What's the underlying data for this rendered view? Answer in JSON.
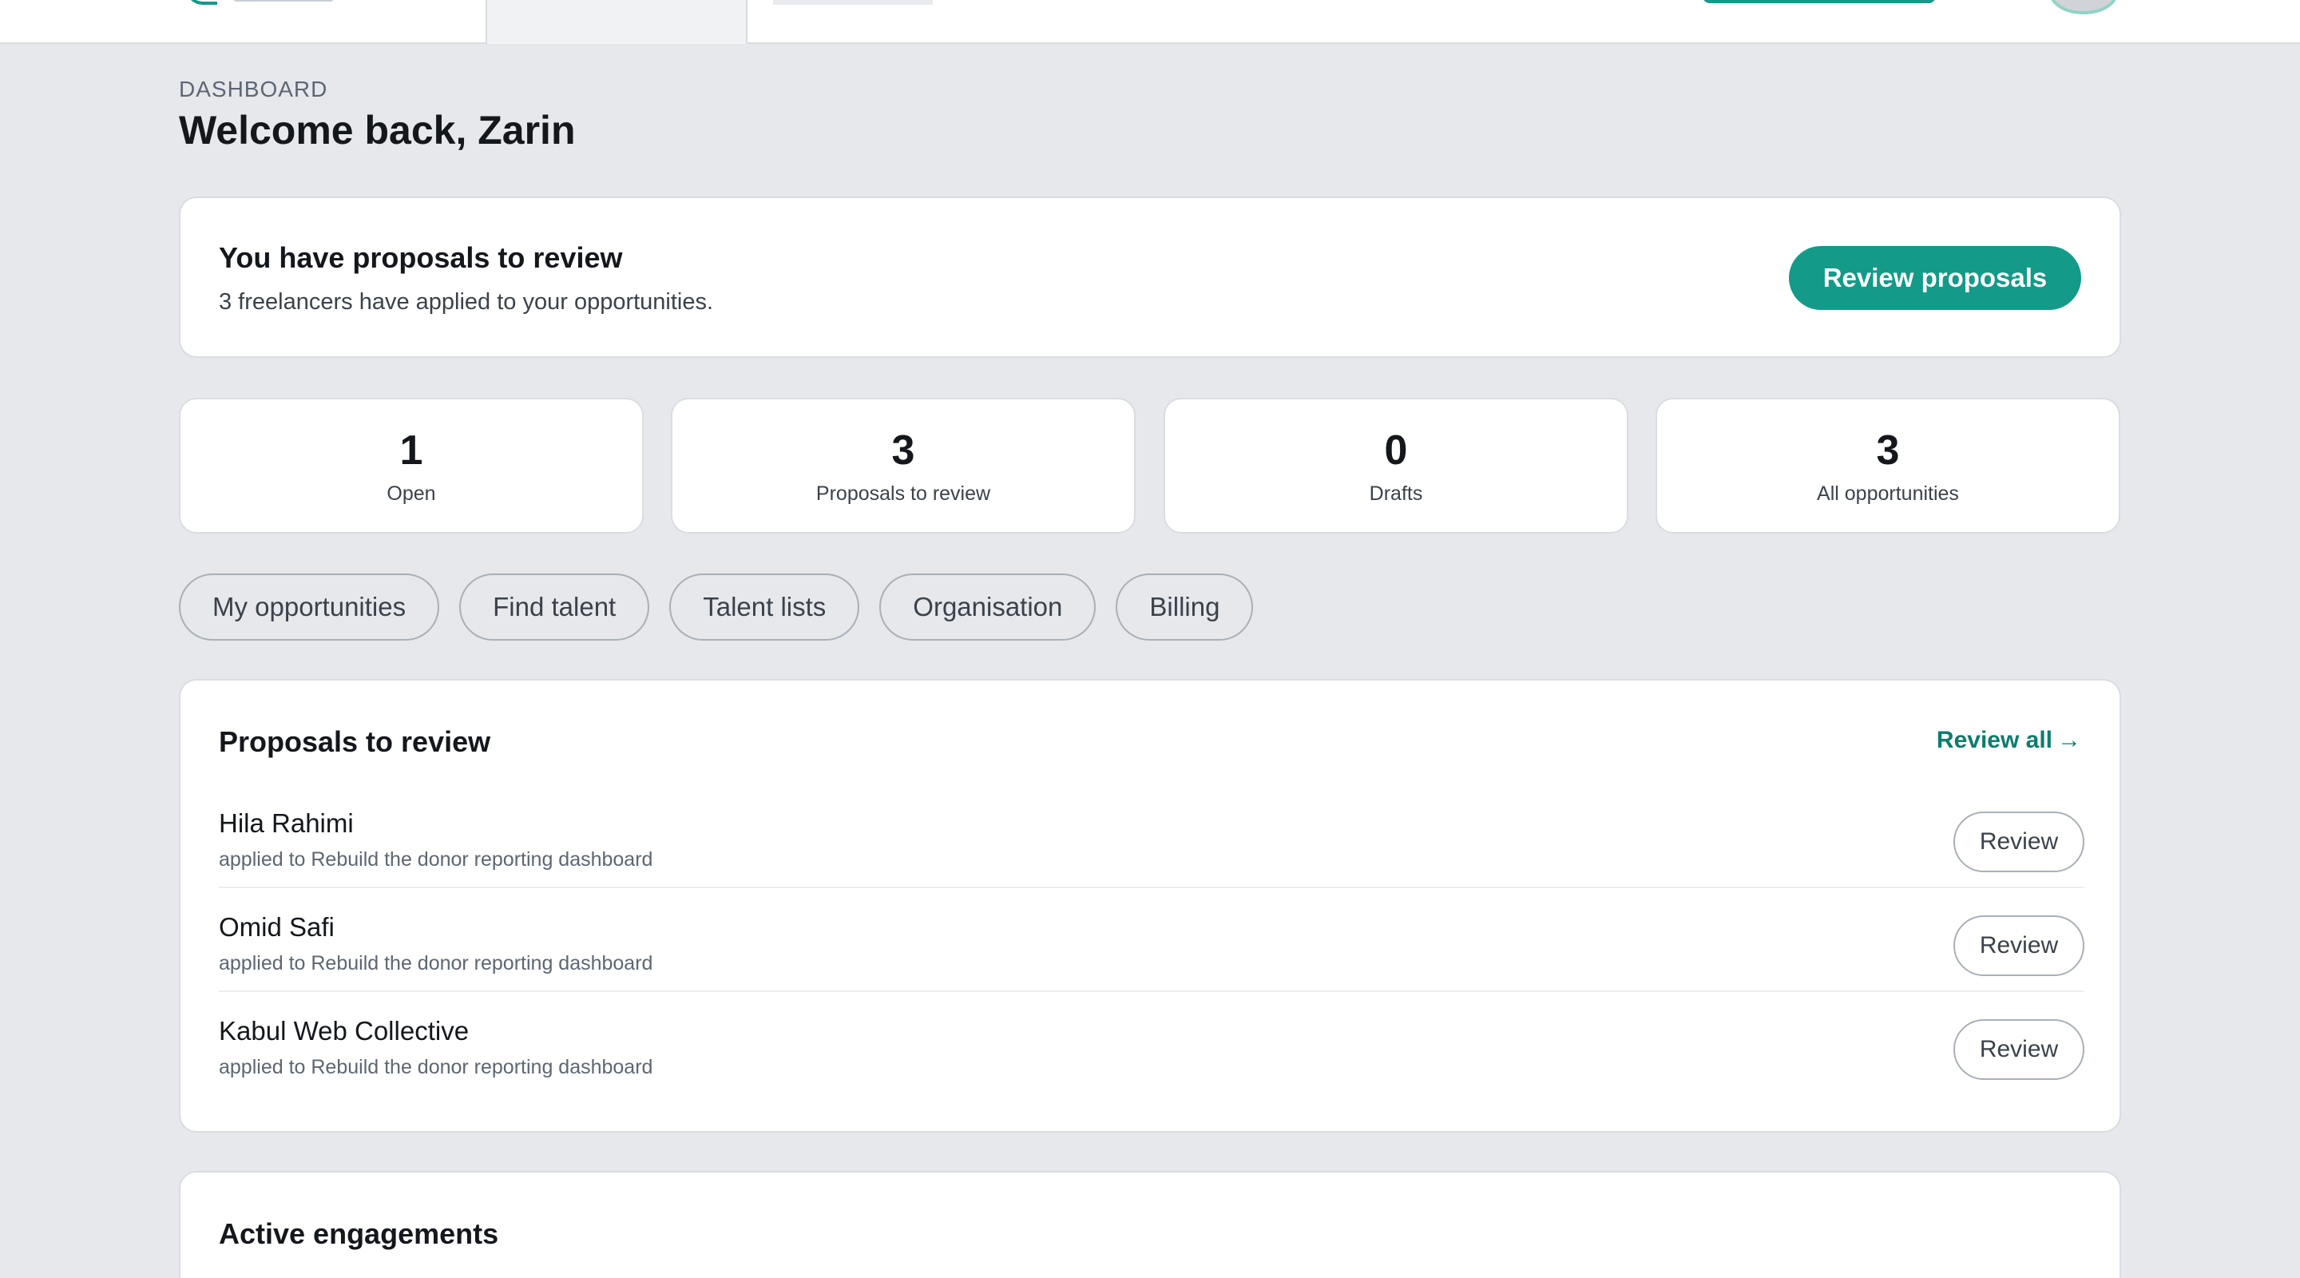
{
  "header": {
    "eyebrow": "DASHBOARD",
    "title": "Welcome back, Zarin"
  },
  "banner": {
    "title": "You have proposals to review",
    "subtitle": "3 freelancers have applied to your opportunities.",
    "button_label": "Review proposals"
  },
  "stats": [
    {
      "value": "1",
      "label": "Open"
    },
    {
      "value": "3",
      "label": "Proposals to review"
    },
    {
      "value": "0",
      "label": "Drafts"
    },
    {
      "value": "3",
      "label": "All opportunities"
    }
  ],
  "quick_links": [
    {
      "label": "My opportunities"
    },
    {
      "label": "Find talent"
    },
    {
      "label": "Talent lists"
    },
    {
      "label": "Organisation"
    },
    {
      "label": "Billing"
    }
  ],
  "proposals": {
    "title": "Proposals to review",
    "review_all_label": "Review all",
    "review_all_arrow": "→",
    "items": [
      {
        "name": "Hila Rahimi",
        "meta": "applied to Rebuild the donor reporting dashboard",
        "action": "Review"
      },
      {
        "name": "Omid Safi",
        "meta": "applied to Rebuild the donor reporting dashboard",
        "action": "Review"
      },
      {
        "name": "Kabul Web Collective",
        "meta": "applied to Rebuild the donor reporting dashboard",
        "action": "Review"
      }
    ]
  },
  "engagements": {
    "title": "Active engagements"
  },
  "colors": {
    "brand": "#139a88",
    "link": "#0e7c6e",
    "background": "#e6e8ec"
  }
}
